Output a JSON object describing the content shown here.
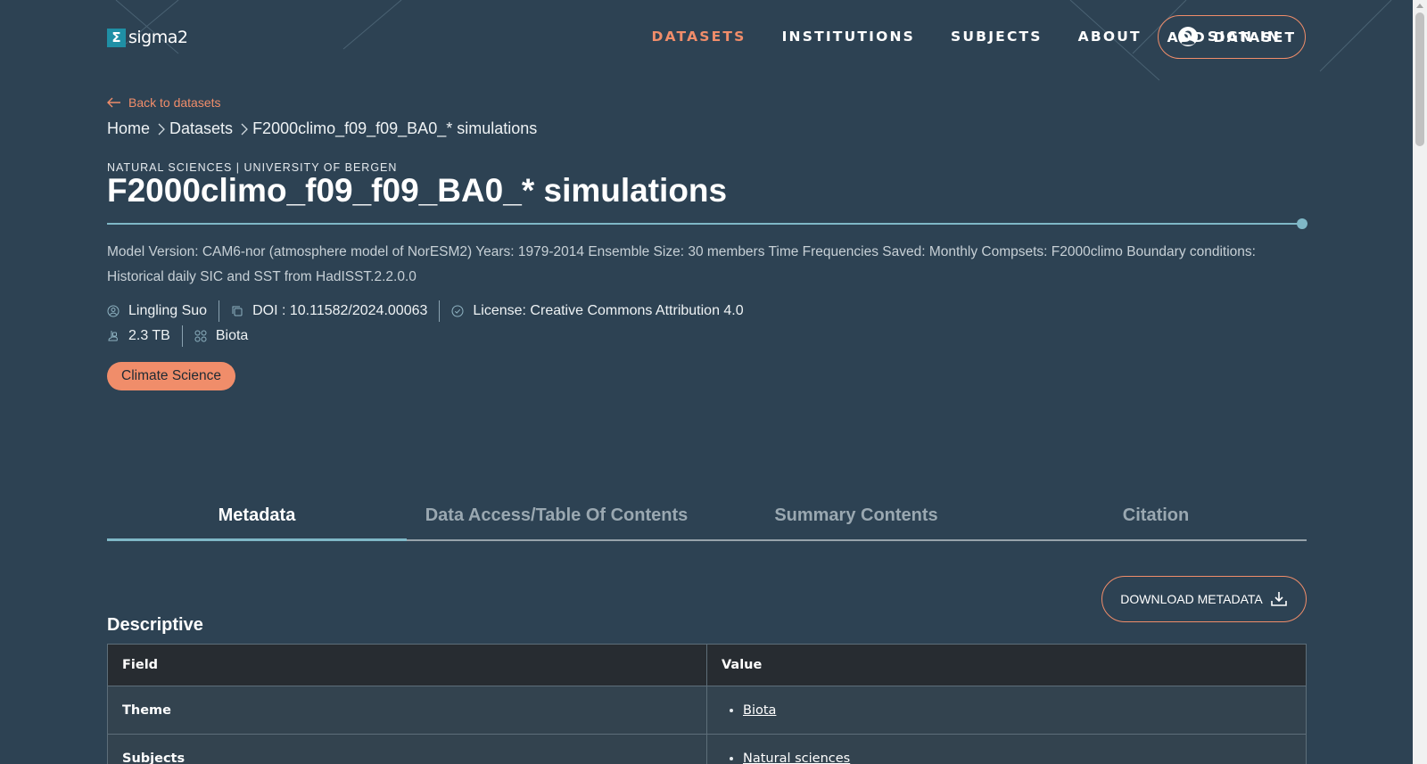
{
  "header": {
    "logo_text": "sigma2",
    "logo_mark": "Σ",
    "nav": [
      {
        "label": "DATASETS",
        "active": true
      },
      {
        "label": "INSTITUTIONS",
        "active": false
      },
      {
        "label": "SUBJECTS",
        "active": false
      },
      {
        "label": "ABOUT",
        "active": false
      }
    ],
    "sign_in_label": "SIGN IN",
    "add_dataset_label": "ADD DATASET"
  },
  "back_label": "Back to datasets",
  "breadcrumb": [
    "Home",
    "Datasets",
    "F2000climo_f09_f09_BA0_* simulations"
  ],
  "dataset": {
    "subtitle": "NATURAL SCIENCES | UNIVERSITY OF BERGEN",
    "title": "F2000climo_f09_f09_BA0_* simulations",
    "description": "Model Version: CAM6-nor (atmosphere model of NorESM2) Years: 1979-2014 Ensemble Size: 30 members Time Frequencies Saved: Monthly Compsets: F2000climo Boundary conditions: Historical daily SIC and SST from HadISST.2.2.0.0",
    "author": "Lingling Suo",
    "doi": "DOI : 10.11582/2024.00063",
    "license": "License: Creative Commons Attribution 4.0",
    "size": "2.3 TB",
    "theme": "Biota",
    "tag": "Climate Science"
  },
  "tabs": [
    "Metadata",
    "Data Access/Table Of Contents",
    "Summary Contents",
    "Citation"
  ],
  "download_metadata_label": "DOWNLOAD METADATA",
  "section_title": "Descriptive",
  "table": {
    "headers": [
      "Field",
      "Value"
    ],
    "rows": [
      {
        "field": "Theme",
        "value": "Biota"
      },
      {
        "field": "Subjects",
        "value": "Natural sciences"
      }
    ]
  },
  "colors": {
    "background": "#2d4253",
    "accent": "#f08d6a",
    "rule": "#7fb8c7",
    "table_header": "#272c31"
  }
}
